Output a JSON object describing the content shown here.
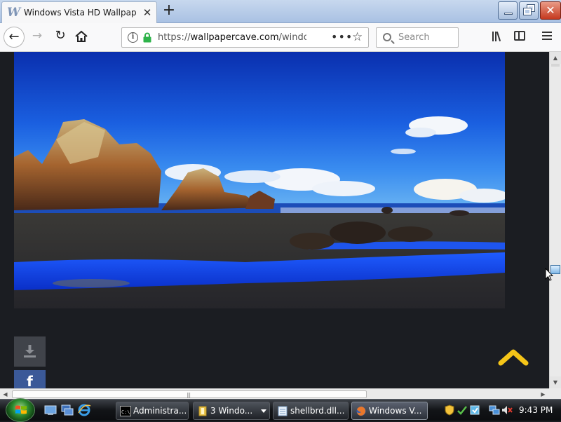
{
  "browser": {
    "tab": {
      "title": "Windows Vista HD Wallpapers",
      "favicon_icon": "wallpapercave-w-icon",
      "close_icon": "close-icon"
    },
    "new_tab_icon": "plus-icon",
    "window_controls": [
      "minimize",
      "maximize",
      "close"
    ],
    "nav": {
      "back_icon": "arrow-left-icon",
      "forward_icon": "arrow-right-icon",
      "reload_icon": "reload-icon",
      "home_icon": "home-icon"
    },
    "url": {
      "protocol": "https://",
      "host": "wallpapercave.com",
      "path": "/window",
      "more_label": "•••"
    },
    "search": {
      "placeholder": "Search"
    }
  },
  "page": {
    "wallpaper_alt": "Windows Vista HD wallpaper of rocky coast and blue sky",
    "download_icon": "download-icon",
    "facebook_label": "f",
    "scroll_top_icon": "chevron-up-icon",
    "accent_color": "#f5c518"
  },
  "taskbar": {
    "tasks": [
      {
        "label": "Administra...",
        "icon": "cmd-icon"
      },
      {
        "label": "3 Windo...",
        "icon": "folder-icon"
      },
      {
        "label": "shellbrd.dll...",
        "icon": "notepad-icon"
      },
      {
        "label": "Windows V...",
        "icon": "firefox-icon"
      }
    ],
    "clock": "9:43 PM"
  }
}
